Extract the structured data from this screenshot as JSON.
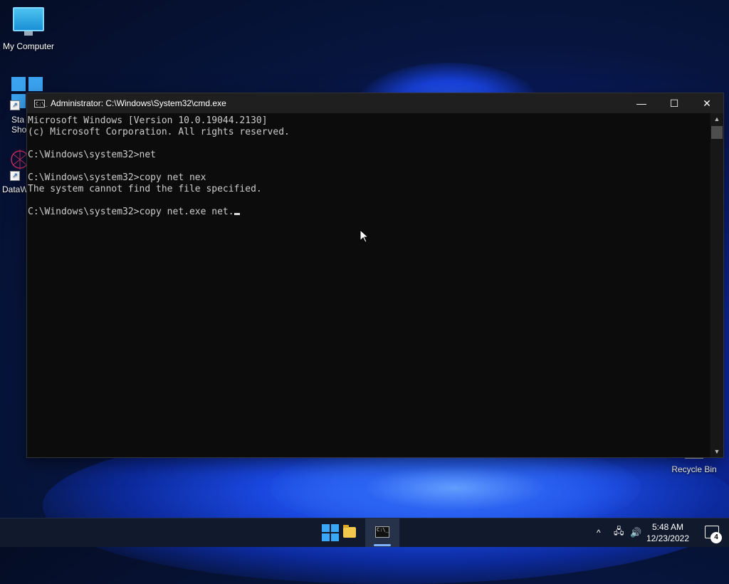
{
  "desktop": {
    "icons": [
      {
        "label": "My Computer"
      },
      {
        "label": "Sta\nShor"
      },
      {
        "label": "DataW"
      },
      {
        "label": "Recycle Bin"
      }
    ]
  },
  "window": {
    "title": "Administrator: C:\\Windows\\System32\\cmd.exe",
    "title_icon_glyph": "C:\\_",
    "controls": {
      "minimize": "—",
      "maximize": "☐",
      "close": "✕"
    }
  },
  "console": {
    "lines": [
      "Microsoft Windows [Version 10.0.19044.2130]",
      "(c) Microsoft Corporation. All rights reserved.",
      "",
      "C:\\Windows\\system32>net",
      "",
      "C:\\Windows\\system32>copy net nex",
      "The system cannot find the file specified.",
      "",
      "C:\\Windows\\system32>copy net.exe net."
    ]
  },
  "scrollbar": {
    "up": "▲",
    "down": "▼"
  },
  "taskbar": {
    "cmd_glyph": "C:\\_",
    "tray": {
      "chevron": "^",
      "network": "🖧",
      "volume": "🔊"
    },
    "clock": {
      "time": "5:48 AM",
      "date": "12/23/2022"
    },
    "notifications": {
      "count": "4"
    }
  },
  "colors": {
    "console_bg": "#0c0c0c",
    "console_text": "#cccccc",
    "taskbar_bg": "#101a2c"
  }
}
